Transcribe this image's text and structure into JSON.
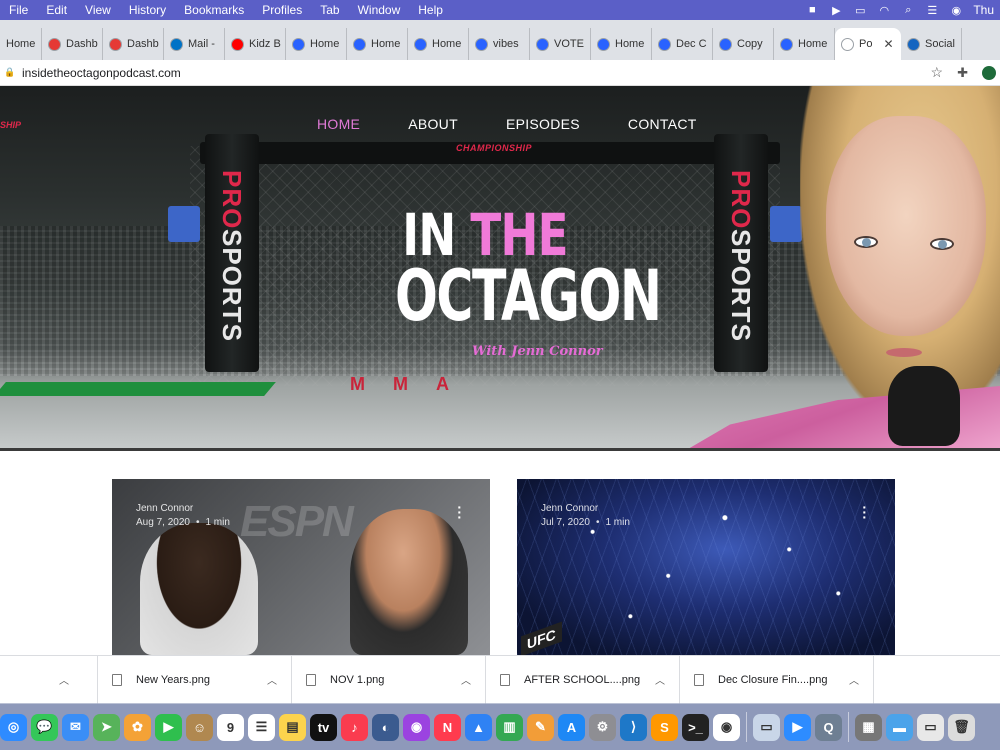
{
  "menubar": {
    "items": [
      "File",
      "Edit",
      "View",
      "History",
      "Bookmarks",
      "Profiles",
      "Tab",
      "Window",
      "Help"
    ],
    "clock": "Thu"
  },
  "tabs": [
    {
      "label": "Home",
      "color": "#dee1e6"
    },
    {
      "label": "Dashb",
      "color": "#e53935"
    },
    {
      "label": "Dashb",
      "color": "#e53935"
    },
    {
      "label": "Mail -",
      "color": "#0072c6"
    },
    {
      "label": "Kidz B",
      "color": "#ff0000"
    },
    {
      "label": "Home",
      "color": "#2962ff"
    },
    {
      "label": "Home",
      "color": "#2962ff"
    },
    {
      "label": "Home",
      "color": "#2962ff"
    },
    {
      "label": "vibes",
      "color": "#2962ff"
    },
    {
      "label": "VOTE",
      "color": "#2962ff"
    },
    {
      "label": "Home",
      "color": "#2962ff"
    },
    {
      "label": "Dec C",
      "color": "#2962ff"
    },
    {
      "label": "Copy",
      "color": "#2962ff"
    },
    {
      "label": "Home",
      "color": "#2962ff"
    },
    {
      "label": "Po",
      "color": "#ffffff",
      "active": true
    },
    {
      "label": "Social",
      "color": "#1565c0"
    }
  ],
  "address": {
    "url": "insidetheoctagonpodcast.com"
  },
  "hero": {
    "nav": [
      "HOME",
      "ABOUT",
      "EPISODES",
      "CONTACT"
    ],
    "title_in": "IN",
    "title_the": "THE",
    "title_octagon": "OCTAGON",
    "subtitle": "With Jenn Connor",
    "championship": "CHAMPIONSHIP",
    "ship": "SHIP",
    "post_pro": "PRO",
    "post_sports": "SPORTS",
    "mma": "MMA"
  },
  "posts": [
    {
      "author": "Jenn Connor",
      "date": "Aug 7, 2020",
      "read": "1 min",
      "overlay": "ESPN"
    },
    {
      "author": "Jenn Connor",
      "date": "Jul 7, 2020",
      "read": "1 min",
      "overlay": "UFC"
    }
  ],
  "downloads": [
    "New Years.png",
    "NOV 1.png",
    "AFTER SCHOOL....png",
    "Dec Closure Fin....png"
  ],
  "dock": [
    {
      "name": "safari-icon",
      "color": "#2e8bff",
      "glyph": "◎"
    },
    {
      "name": "messages-icon",
      "color": "#34c759",
      "glyph": "💬"
    },
    {
      "name": "mail-icon",
      "color": "#3a8ef6",
      "glyph": "✉"
    },
    {
      "name": "maps-icon",
      "color": "#57b35a",
      "glyph": "➤"
    },
    {
      "name": "photos-icon",
      "color": "#f4a236",
      "glyph": "✿"
    },
    {
      "name": "facetime-icon",
      "color": "#2fbf4e",
      "glyph": "▶"
    },
    {
      "name": "contacts-icon",
      "color": "#b08850",
      "glyph": "☺"
    },
    {
      "name": "calendar-icon",
      "color": "#ffffff",
      "glyph": "9"
    },
    {
      "name": "reminders-icon",
      "color": "#ffffff",
      "glyph": "☰"
    },
    {
      "name": "notes-icon",
      "color": "#fcd34d",
      "glyph": "▤"
    },
    {
      "name": "apple-tv-icon",
      "color": "#111111",
      "glyph": "tv"
    },
    {
      "name": "music-icon",
      "color": "#fa3c4f",
      "glyph": "♪"
    },
    {
      "name": "mysql-icon",
      "color": "#3b5b8f",
      "glyph": "◐"
    },
    {
      "name": "podcasts-icon",
      "color": "#9b43e0",
      "glyph": "◉"
    },
    {
      "name": "news-icon",
      "color": "#ff3b4e",
      "glyph": "N"
    },
    {
      "name": "keynote-icon",
      "color": "#2f82f4",
      "glyph": "▲"
    },
    {
      "name": "numbers-icon",
      "color": "#34a853",
      "glyph": "▥"
    },
    {
      "name": "pages-icon",
      "color": "#f29d38",
      "glyph": "✎"
    },
    {
      "name": "app-store-icon",
      "color": "#1e88f5",
      "glyph": "A"
    },
    {
      "name": "system-preferences-icon",
      "color": "#8e8e93",
      "glyph": "⚙"
    },
    {
      "name": "vscode-icon",
      "color": "#1e78c8",
      "glyph": "⟩"
    },
    {
      "name": "sublime-icon",
      "color": "#ff9800",
      "glyph": "S"
    },
    {
      "name": "terminal-icon",
      "color": "#222222",
      "glyph": ">_"
    },
    {
      "name": "chrome-icon",
      "color": "#ffffff",
      "glyph": "◉"
    },
    {
      "name": "sep",
      "color": "",
      "glyph": ""
    },
    {
      "name": "preview-icon",
      "color": "#c9d6e8",
      "glyph": "▭"
    },
    {
      "name": "zoom-icon",
      "color": "#2d8cff",
      "glyph": "▶"
    },
    {
      "name": "quicktime-icon",
      "color": "#6e7f93",
      "glyph": "Q"
    },
    {
      "name": "sep",
      "color": "",
      "glyph": ""
    },
    {
      "name": "screenshot-thumb-icon",
      "color": "#777777",
      "glyph": "▦"
    },
    {
      "name": "folder-icon",
      "color": "#4ba3ea",
      "glyph": "▬"
    },
    {
      "name": "window-thumb-icon",
      "color": "#e8e8e8",
      "glyph": "▭"
    },
    {
      "name": "trash-icon",
      "color": "#dcdcdc",
      "glyph": "🗑"
    }
  ]
}
